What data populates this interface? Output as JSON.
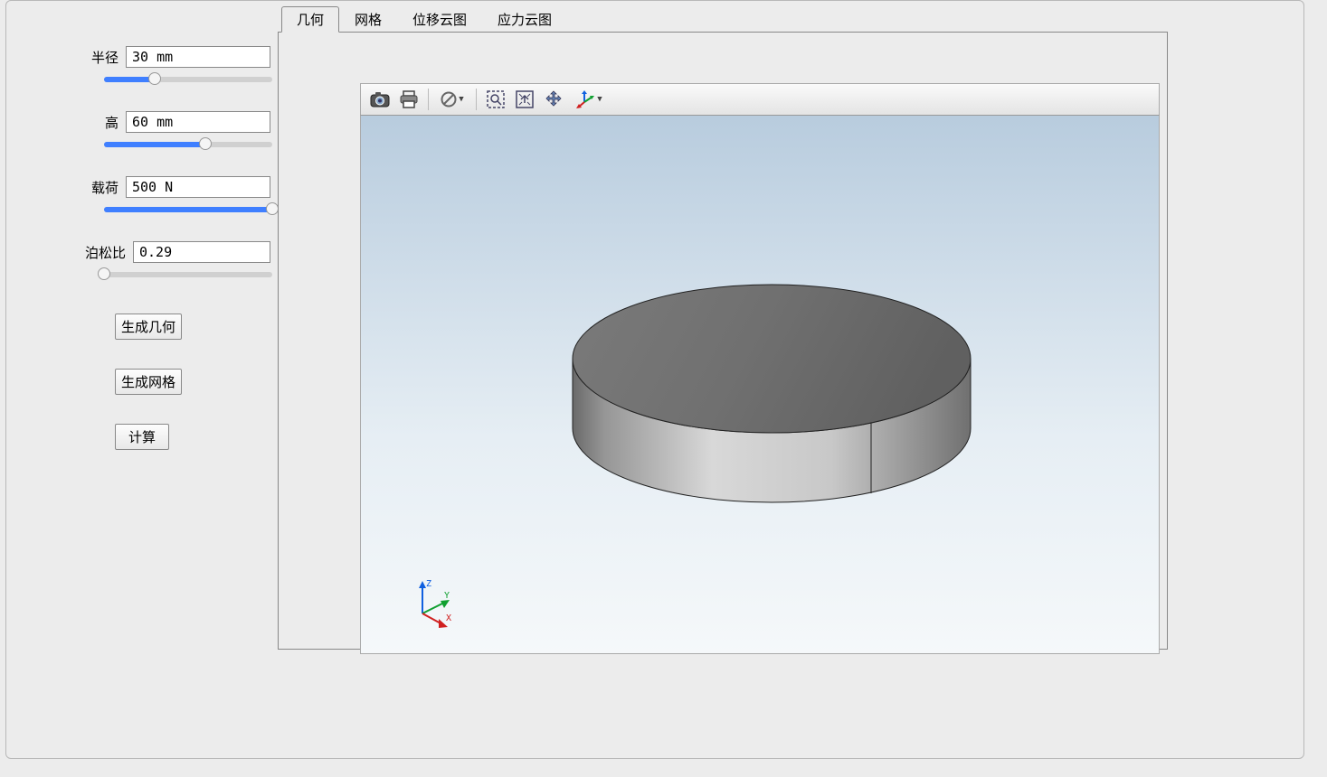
{
  "sidebar": {
    "params": {
      "radius": {
        "label": "半径",
        "value": "30 mm",
        "fill_pct": 30
      },
      "height": {
        "label": "高",
        "value": "60 mm",
        "fill_pct": 60
      },
      "load": {
        "label": "载荷",
        "value": "500 N",
        "fill_pct": 100
      },
      "poisson": {
        "label": "泊松比",
        "value": "0.29",
        "fill_pct": 0
      }
    },
    "buttons": {
      "gen_geom": "生成几何",
      "gen_mesh": "生成网格",
      "compute": "计算"
    }
  },
  "tabs": [
    "几何",
    "网格",
    "位移云图",
    "应力云图"
  ],
  "active_tab_index": 0,
  "viewport_toolbar": {
    "camera": "camera-icon",
    "print": "print-icon",
    "filter": "no-symbol-icon",
    "zoombox": "zoom-box-icon",
    "fit": "fit-view-icon",
    "pan": "pan-icon",
    "axes": "axes-icon"
  },
  "gizmo": {
    "x": "X",
    "y": "Y",
    "z": "Z"
  }
}
